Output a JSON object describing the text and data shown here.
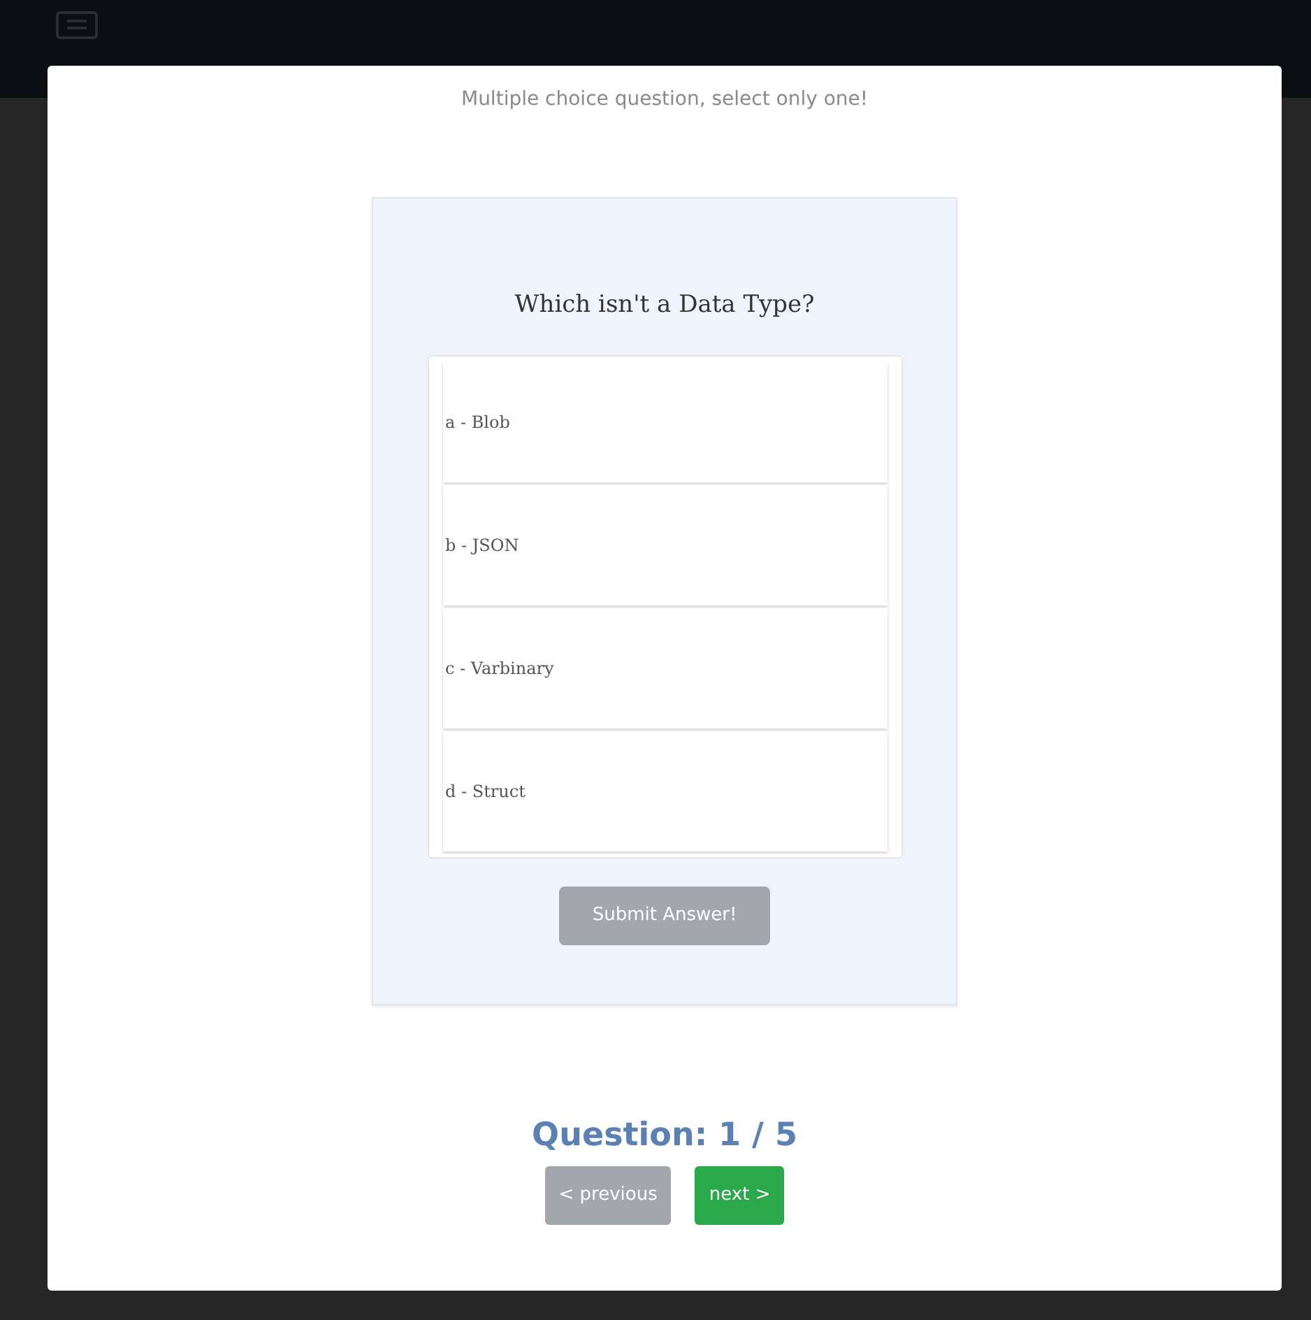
{
  "instruction": "Multiple choice question, select only one!",
  "question": "Which isn't a Data Type?",
  "options": [
    {
      "label": "a - Blob",
      "selected": false
    },
    {
      "label": "b - JSON",
      "selected": false
    },
    {
      "label": "c - Varbinary",
      "selected": false
    },
    {
      "label": "d - Struct",
      "selected": false
    }
  ],
  "submit": {
    "label": "Submit Answer!",
    "disabled": true
  },
  "progress": "Question: 1 / 5",
  "nav": [
    {
      "label": "< previous",
      "disabled": true
    },
    {
      "label": "next >",
      "disabled": false
    }
  ]
}
